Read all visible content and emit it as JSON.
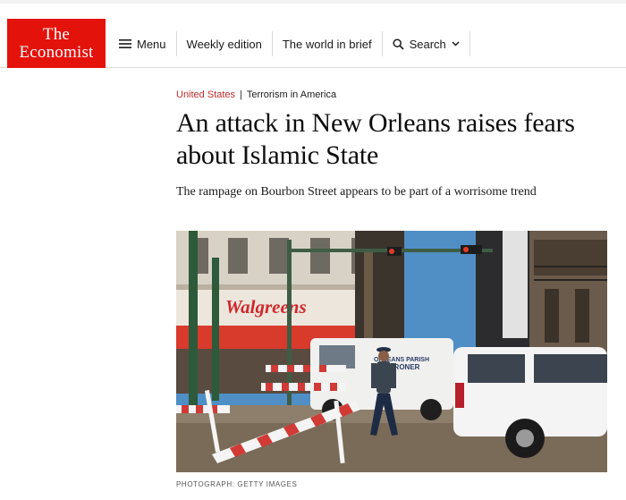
{
  "brand": {
    "logo_line1": "The",
    "logo_line2": "Economist",
    "brand_color": "#e3120b"
  },
  "nav": {
    "menu": {
      "label": "Menu",
      "icon": "hamburger-icon"
    },
    "weekly": {
      "label": "Weekly edition"
    },
    "world": {
      "label": "The world in brief"
    },
    "search": {
      "label": "Search",
      "icon": "search-icon",
      "dropdown_icon": "chevron-down-icon"
    }
  },
  "article": {
    "section": "United States",
    "separator": "|",
    "topic": "Terrorism in America",
    "headline": "An attack in New Orleans raises fears about Islamic State",
    "subheadline": "The rampage on Bourbon Street appears to be part of a worrisome trend",
    "image": {
      "store_sign": "Walgreens",
      "van_text_line1": "ORLEANS PARISH",
      "van_text_line2": "CORONER",
      "credit": "Photograph: Getty Images"
    }
  },
  "colors": {
    "section_red": "#c12d2d",
    "text": "#0d0d0d",
    "rule": "#d9d9d9"
  }
}
